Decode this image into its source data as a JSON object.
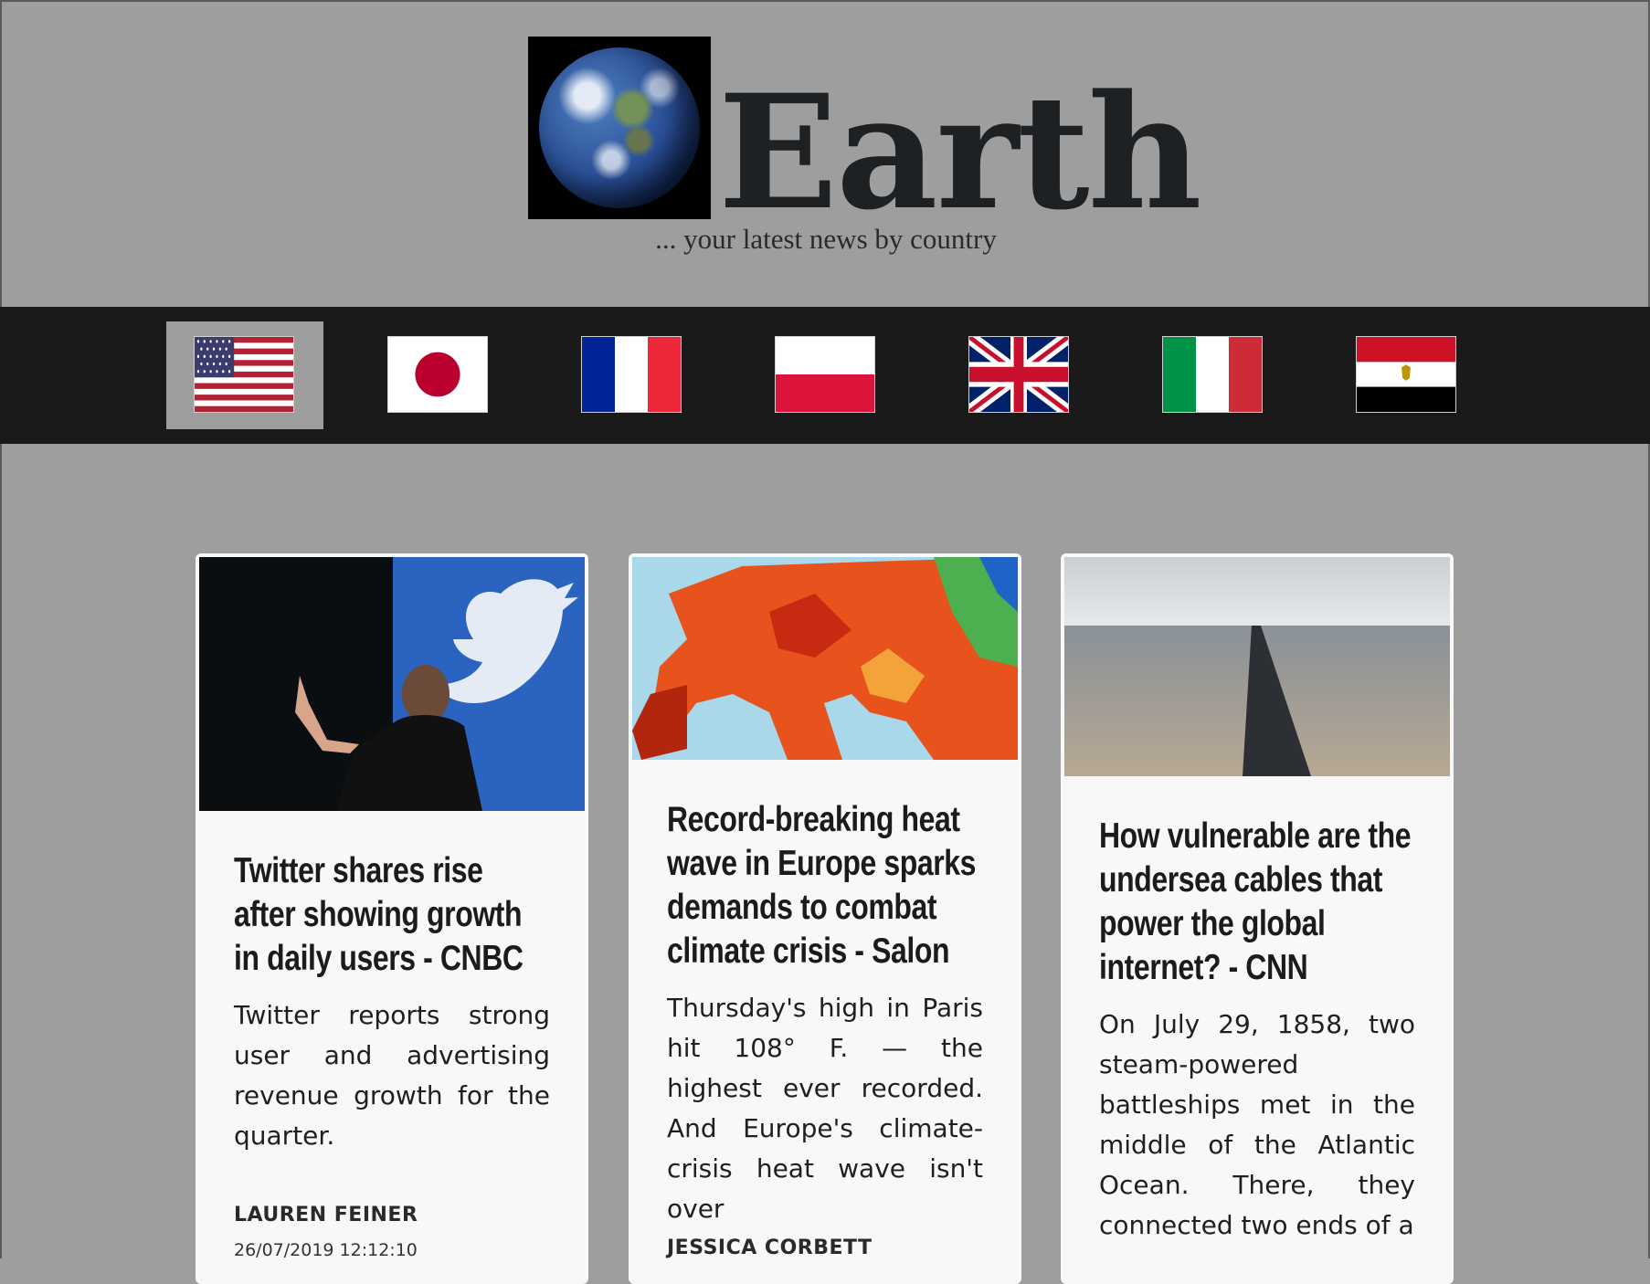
{
  "header": {
    "title": "Earth",
    "tagline": "... your latest news by country"
  },
  "nav": {
    "countries": [
      {
        "name": "United States",
        "active": true
      },
      {
        "name": "Japan"
      },
      {
        "name": "France"
      },
      {
        "name": "Poland"
      },
      {
        "name": "United Kingdom"
      },
      {
        "name": "Italy"
      },
      {
        "name": "Egypt"
      }
    ]
  },
  "articles": [
    {
      "title": "Twitter shares rise after showing growth in daily users - CNBC",
      "description": "Twitter reports strong user and advertising revenue growth for the quarter.",
      "author": "LAUREN FEINER",
      "date": "26/07/2019 12:12:10",
      "image": "twitter-ceo-photo"
    },
    {
      "title": "Record-breaking heat wave in Europe sparks demands to combat climate crisis - Salon",
      "description": "Thursday's high in Paris hit 108° F. — the highest ever recorded. And Europe's climate-crisis heat wave isn't over",
      "author": "JESSICA CORBETT",
      "image": "europe-heat-map"
    },
    {
      "title": "How vulnerable are the undersea cables that power the global internet? - CNN",
      "description": "On July 29, 1858, two steam-powered battleships met in the middle of the Atlantic Ocean. There, they connected two ends of a",
      "image": "undersea-cable-beach-photo"
    }
  ],
  "colors": {
    "page_bg": "#9e9e9e",
    "nav_bg": "#1a1a1a",
    "card_bg": "#f8f8f8",
    "title_text": "#1e2124"
  }
}
